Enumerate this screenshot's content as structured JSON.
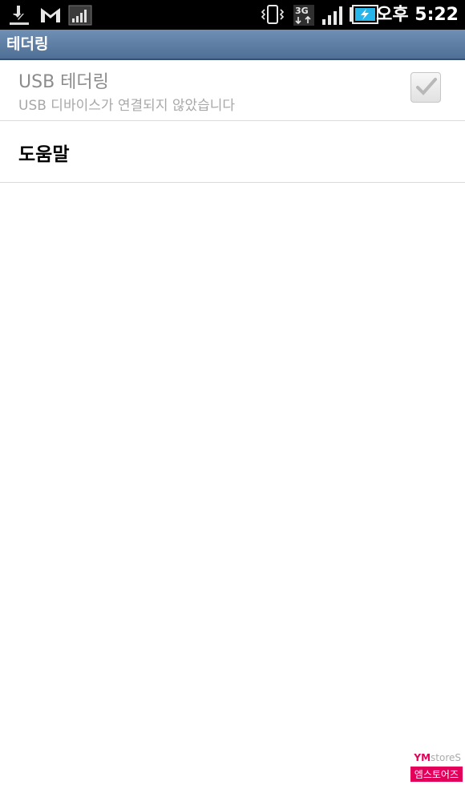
{
  "status_bar": {
    "time": "오후 5:22",
    "left_icons": [
      "download-complete-icon",
      "gmail-icon",
      "signal-strength-icon"
    ],
    "right_icons": [
      "vibrate-icon",
      "3g-data-icon",
      "signal-bars-icon",
      "battery-charging-icon"
    ]
  },
  "title_bar": {
    "title": "테더링"
  },
  "preferences": {
    "usb_tethering": {
      "title": "USB 테더링",
      "summary": "USB 디바이스가 연결되지 않았습니다",
      "checked": false,
      "enabled": false
    },
    "help": {
      "title": "도움말"
    }
  },
  "watermark": {
    "logo_prefix": "YM",
    "logo_suffix": "storeS",
    "tag": "엠스토어즈"
  },
  "colors": {
    "title_bar": "#5b7aa1",
    "status_bar": "#000000",
    "accent_watermark": "#e3005a",
    "battery_cyan": "#27b6ec"
  }
}
